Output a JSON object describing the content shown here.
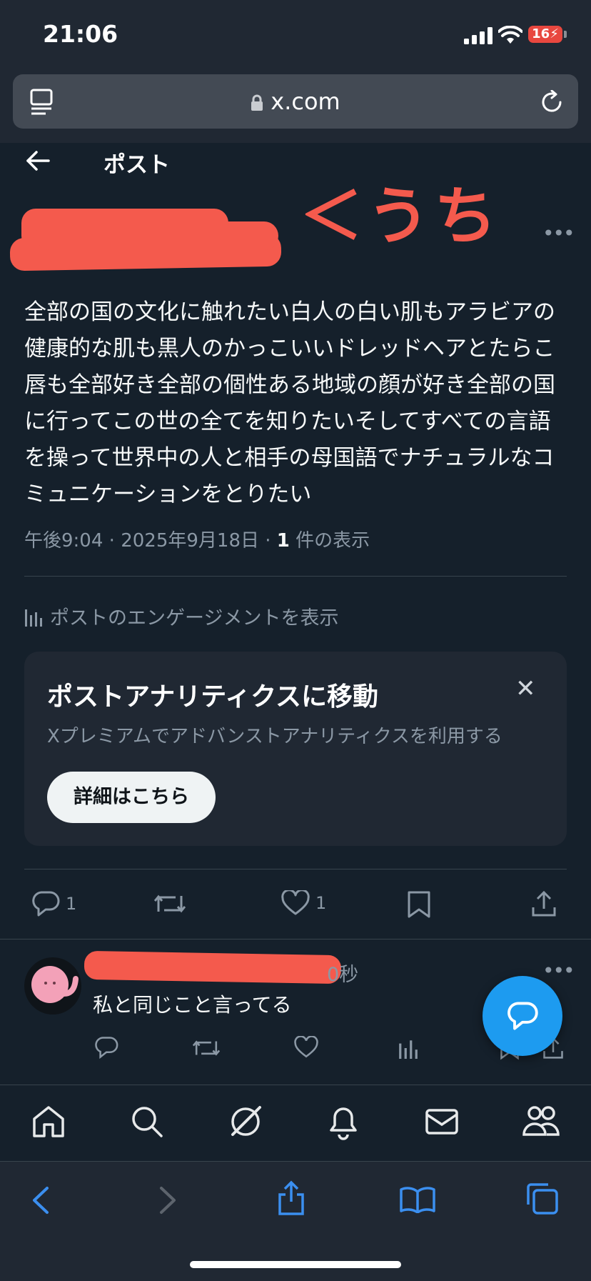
{
  "status_bar": {
    "time": "21:06",
    "battery": "16"
  },
  "browser": {
    "url": "x.com"
  },
  "header": {
    "title": "ポスト"
  },
  "post": {
    "handwritten_note": "うち",
    "body": "全部の国の文化に触れたい白人の白い肌もアラビアの健康的な肌も黒人のかっこいいドレッドヘアとたらこ唇も全部好き全部の個性ある地域の顔が好き全部の国に行ってこの世の全てを知りたいそしてすべての言語を操って世界中の人と相手の母国語でナチュラルなコミュニケーションをとりたい",
    "time": "午後9:04",
    "date": "2025年9月18日",
    "views_count": "1",
    "views_label": "件の表示",
    "engagement_link": "ポストのエンゲージメントを表示"
  },
  "analytics_card": {
    "title": "ポストアナリティクスに移動",
    "subtitle": "Xプレミアムでアドバンストアナリティクスを利用する",
    "button_label": "詳細はこちら"
  },
  "actions": {
    "reply_count": "1",
    "like_count": "1"
  },
  "reply": {
    "time_fragment": "0秒",
    "text": "私と同じこと言ってる"
  },
  "colors": {
    "background": "#15202b",
    "accent": "#1d9bf0",
    "redaction": "#f45a4d"
  }
}
